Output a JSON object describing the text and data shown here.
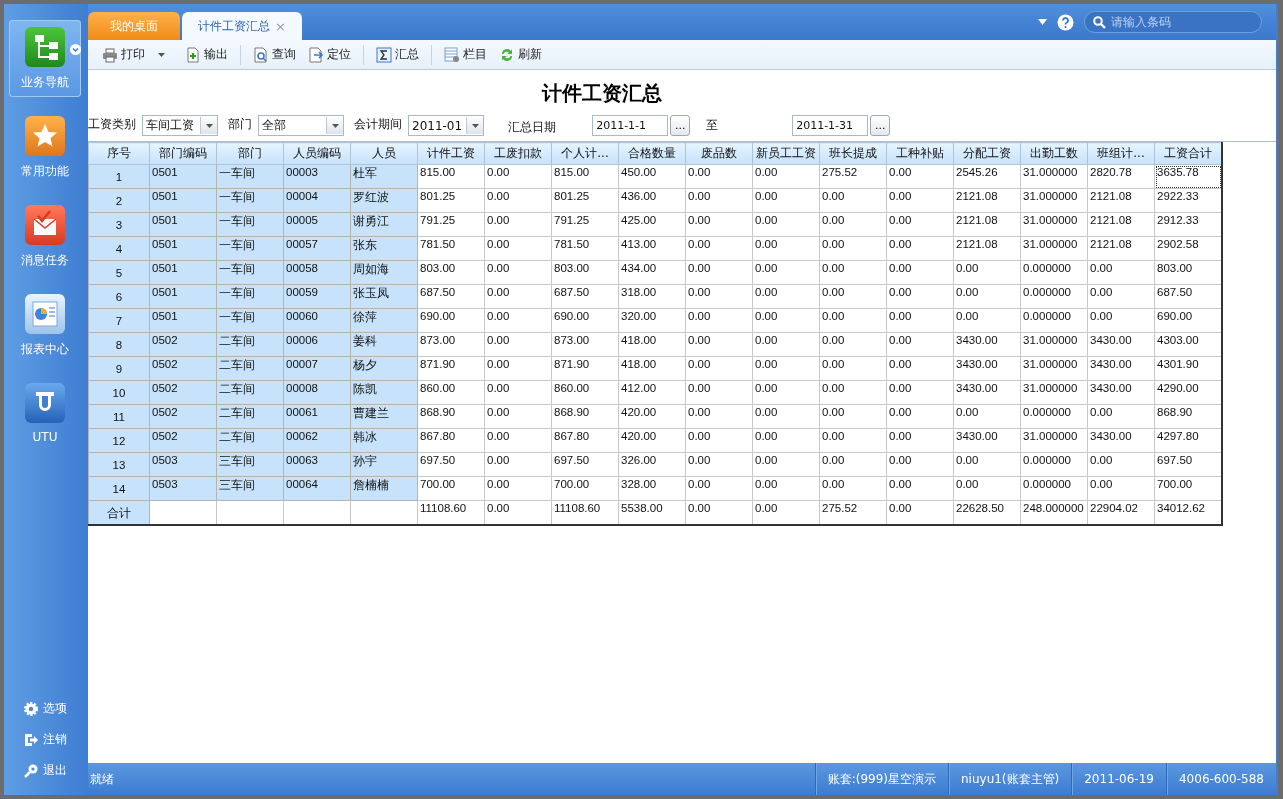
{
  "sidebar": {
    "nav": [
      {
        "label": "业务导航",
        "selected": true
      },
      {
        "label": "常用功能",
        "selected": false
      },
      {
        "label": "消息任务",
        "selected": false
      },
      {
        "label": "报表中心",
        "selected": false
      },
      {
        "label": "UTU",
        "selected": false
      }
    ],
    "bottom": [
      {
        "label": "选项"
      },
      {
        "label": "注销"
      },
      {
        "label": "退出"
      }
    ]
  },
  "tabs": [
    {
      "label": "我的桌面",
      "selected": false
    },
    {
      "label": "计件工资汇总",
      "selected": true,
      "close": "×"
    }
  ],
  "search": {
    "placeholder": "请输入条码"
  },
  "toolbar": [
    [
      {
        "label": "打印",
        "menu": true
      },
      {
        "label": "输出",
        "menu": false
      }
    ],
    [
      {
        "label": "查询",
        "menu": false
      },
      {
        "label": "定位",
        "menu": false
      }
    ],
    [
      {
        "label": "汇总",
        "menu": false
      }
    ],
    [
      {
        "label": "栏目",
        "menu": false
      },
      {
        "label": "刷新",
        "menu": false
      }
    ]
  ],
  "report": {
    "title": "计件工资汇总",
    "filters": [
      {
        "kind": "select",
        "label": "工资类别",
        "value": "车间工资"
      },
      {
        "kind": "select",
        "label": "部门",
        "value": "全部"
      },
      {
        "kind": "select",
        "label": "会计期间",
        "value": "2011-01"
      },
      {
        "kind": "date",
        "label": "汇总日期",
        "value": "2011-1-1",
        "button": "..."
      },
      {
        "kind": "date",
        "label": "至",
        "value": "2011-1-31",
        "button": "..."
      }
    ]
  },
  "table": {
    "columns": [
      "序号",
      "部门编码",
      "部门",
      "人员编码",
      "人员",
      "计件工资",
      "工废扣款",
      "个人计...",
      "合格数量",
      "废品数",
      "新员工工资",
      "班长提成",
      "工种补贴",
      "分配工资",
      "出勤工数",
      "班组计...",
      "工资合计"
    ],
    "rows": [
      {
        "focused": true,
        "cells": [
          "1",
          "0501",
          "一车间",
          "00003",
          "杜军",
          "815.00",
          "0.00",
          "815.00",
          "450.00",
          "0.00",
          "0.00",
          "275.52",
          "0.00",
          "2545.26",
          "31.000000",
          "2820.78",
          "3635.78"
        ]
      },
      {
        "focused": false,
        "cells": [
          "2",
          "0501",
          "一车间",
          "00004",
          "罗红波",
          "801.25",
          "0.00",
          "801.25",
          "436.00",
          "0.00",
          "0.00",
          "0.00",
          "0.00",
          "2121.08",
          "31.000000",
          "2121.08",
          "2922.33"
        ]
      },
      {
        "focused": false,
        "cells": [
          "3",
          "0501",
          "一车间",
          "00005",
          "谢勇江",
          "791.25",
          "0.00",
          "791.25",
          "425.00",
          "0.00",
          "0.00",
          "0.00",
          "0.00",
          "2121.08",
          "31.000000",
          "2121.08",
          "2912.33"
        ]
      },
      {
        "focused": false,
        "cells": [
          "4",
          "0501",
          "一车间",
          "00057",
          "张东",
          "781.50",
          "0.00",
          "781.50",
          "413.00",
          "0.00",
          "0.00",
          "0.00",
          "0.00",
          "2121.08",
          "31.000000",
          "2121.08",
          "2902.58"
        ]
      },
      {
        "focused": false,
        "cells": [
          "5",
          "0501",
          "一车间",
          "00058",
          "周如海",
          "803.00",
          "0.00",
          "803.00",
          "434.00",
          "0.00",
          "0.00",
          "0.00",
          "0.00",
          "0.00",
          "0.000000",
          "0.00",
          "803.00"
        ]
      },
      {
        "focused": false,
        "cells": [
          "6",
          "0501",
          "一车间",
          "00059",
          "张玉凤",
          "687.50",
          "0.00",
          "687.50",
          "318.00",
          "0.00",
          "0.00",
          "0.00",
          "0.00",
          "0.00",
          "0.000000",
          "0.00",
          "687.50"
        ]
      },
      {
        "focused": false,
        "cells": [
          "7",
          "0501",
          "一车间",
          "00060",
          "徐萍",
          "690.00",
          "0.00",
          "690.00",
          "320.00",
          "0.00",
          "0.00",
          "0.00",
          "0.00",
          "0.00",
          "0.000000",
          "0.00",
          "690.00"
        ]
      },
      {
        "focused": false,
        "cells": [
          "8",
          "0502",
          "二车间",
          "00006",
          "姜科",
          "873.00",
          "0.00",
          "873.00",
          "418.00",
          "0.00",
          "0.00",
          "0.00",
          "0.00",
          "3430.00",
          "31.000000",
          "3430.00",
          "4303.00"
        ]
      },
      {
        "focused": false,
        "cells": [
          "9",
          "0502",
          "二车间",
          "00007",
          "杨夕",
          "871.90",
          "0.00",
          "871.90",
          "418.00",
          "0.00",
          "0.00",
          "0.00",
          "0.00",
          "3430.00",
          "31.000000",
          "3430.00",
          "4301.90"
        ]
      },
      {
        "focused": false,
        "cells": [
          "10",
          "0502",
          "二车间",
          "00008",
          "陈凯",
          "860.00",
          "0.00",
          "860.00",
          "412.00",
          "0.00",
          "0.00",
          "0.00",
          "0.00",
          "3430.00",
          "31.000000",
          "3430.00",
          "4290.00"
        ]
      },
      {
        "focused": false,
        "cells": [
          "11",
          "0502",
          "二车间",
          "00061",
          "曹建兰",
          "868.90",
          "0.00",
          "868.90",
          "420.00",
          "0.00",
          "0.00",
          "0.00",
          "0.00",
          "0.00",
          "0.000000",
          "0.00",
          "868.90"
        ]
      },
      {
        "focused": false,
        "cells": [
          "12",
          "0502",
          "二车间",
          "00062",
          "韩冰",
          "867.80",
          "0.00",
          "867.80",
          "420.00",
          "0.00",
          "0.00",
          "0.00",
          "0.00",
          "3430.00",
          "31.000000",
          "3430.00",
          "4297.80"
        ]
      },
      {
        "focused": false,
        "cells": [
          "13",
          "0503",
          "三车间",
          "00063",
          "孙宇",
          "697.50",
          "0.00",
          "697.50",
          "326.00",
          "0.00",
          "0.00",
          "0.00",
          "0.00",
          "0.00",
          "0.000000",
          "0.00",
          "697.50"
        ]
      },
      {
        "focused": false,
        "cells": [
          "14",
          "0503",
          "三车间",
          "00064",
          "詹楠楠",
          "700.00",
          "0.00",
          "700.00",
          "328.00",
          "0.00",
          "0.00",
          "0.00",
          "0.00",
          "0.00",
          "0.000000",
          "0.00",
          "700.00"
        ]
      }
    ],
    "total": {
      "label": "合计",
      "cells": [
        "11108.60",
        "0.00",
        "11108.60",
        "5538.00",
        "0.00",
        "0.00",
        "275.52",
        "0.00",
        "22628.50",
        "248.000000",
        "22904.02",
        "34012.62"
      ]
    }
  },
  "status_bar": {
    "message": "就绪",
    "segments": [
      "账套:(999)星空演示",
      "niuyu1(账套主管)",
      "2011-06-19",
      "4006-600-588"
    ]
  }
}
